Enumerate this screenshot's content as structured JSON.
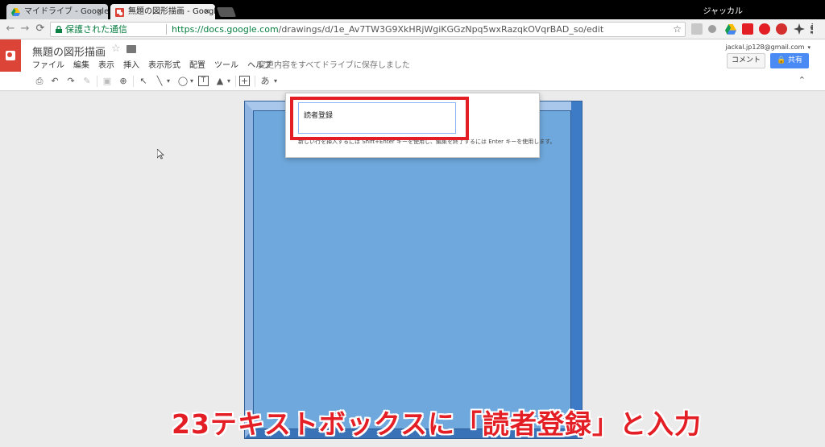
{
  "browser": {
    "tabs": [
      {
        "title": "マイドライブ - Google ドラ",
        "active": false
      },
      {
        "title": "無題の図形描画 - Google",
        "active": true
      }
    ],
    "close_glyph": "×",
    "profile_name": "ジャッカル",
    "secure_label": "保護された通信",
    "url_host": "https://docs.google.com",
    "url_path": "/drawings/d/1e_Av7TW3G9XkHRjWgiKGGzNpq5wxRazqkOVqrBAD_so/edit",
    "back_glyph": "←",
    "forward_glyph": "→",
    "reload_glyph": "⟳",
    "star_glyph": "☆",
    "colors": {
      "secure": "#0b8043",
      "tabbar": "#000000"
    }
  },
  "app": {
    "doc_title": "無題の図形描画",
    "star_glyph": "☆",
    "menu": [
      "ファイル",
      "編集",
      "表示",
      "挿入",
      "表示形式",
      "配置",
      "ツール",
      "ヘルプ"
    ],
    "save_status": "変更内容をすべてドライブに保存しました",
    "account": "jackal.jp128@gmail.com",
    "account_caret": "▾",
    "comment_label": "コメント",
    "share_label": "共有",
    "colors": {
      "brand": "#db4437",
      "share": "#4a8af4"
    }
  },
  "toolbar": {
    "print": "⎙",
    "undo": "↶",
    "redo": "↷",
    "paint_format": "✎",
    "zoom_fit": "▣",
    "zoom": "⊕",
    "select": "↖",
    "line": "╲",
    "shape": "◯",
    "textbox": "T",
    "image": "▲",
    "insert": "+",
    "input_mode": "あ",
    "dropdown": "▾",
    "collapse": "⌃"
  },
  "popup": {
    "input_value": "読者登録",
    "hint": "新しい行を挿入するには Shift+Enter キーを使用し、編集を終了するには Enter キーを使用します。"
  },
  "shape": {
    "type": "bevel",
    "fill": "#6fa8dc"
  },
  "caption": "23テキストボックスに「読者登録」と入力"
}
